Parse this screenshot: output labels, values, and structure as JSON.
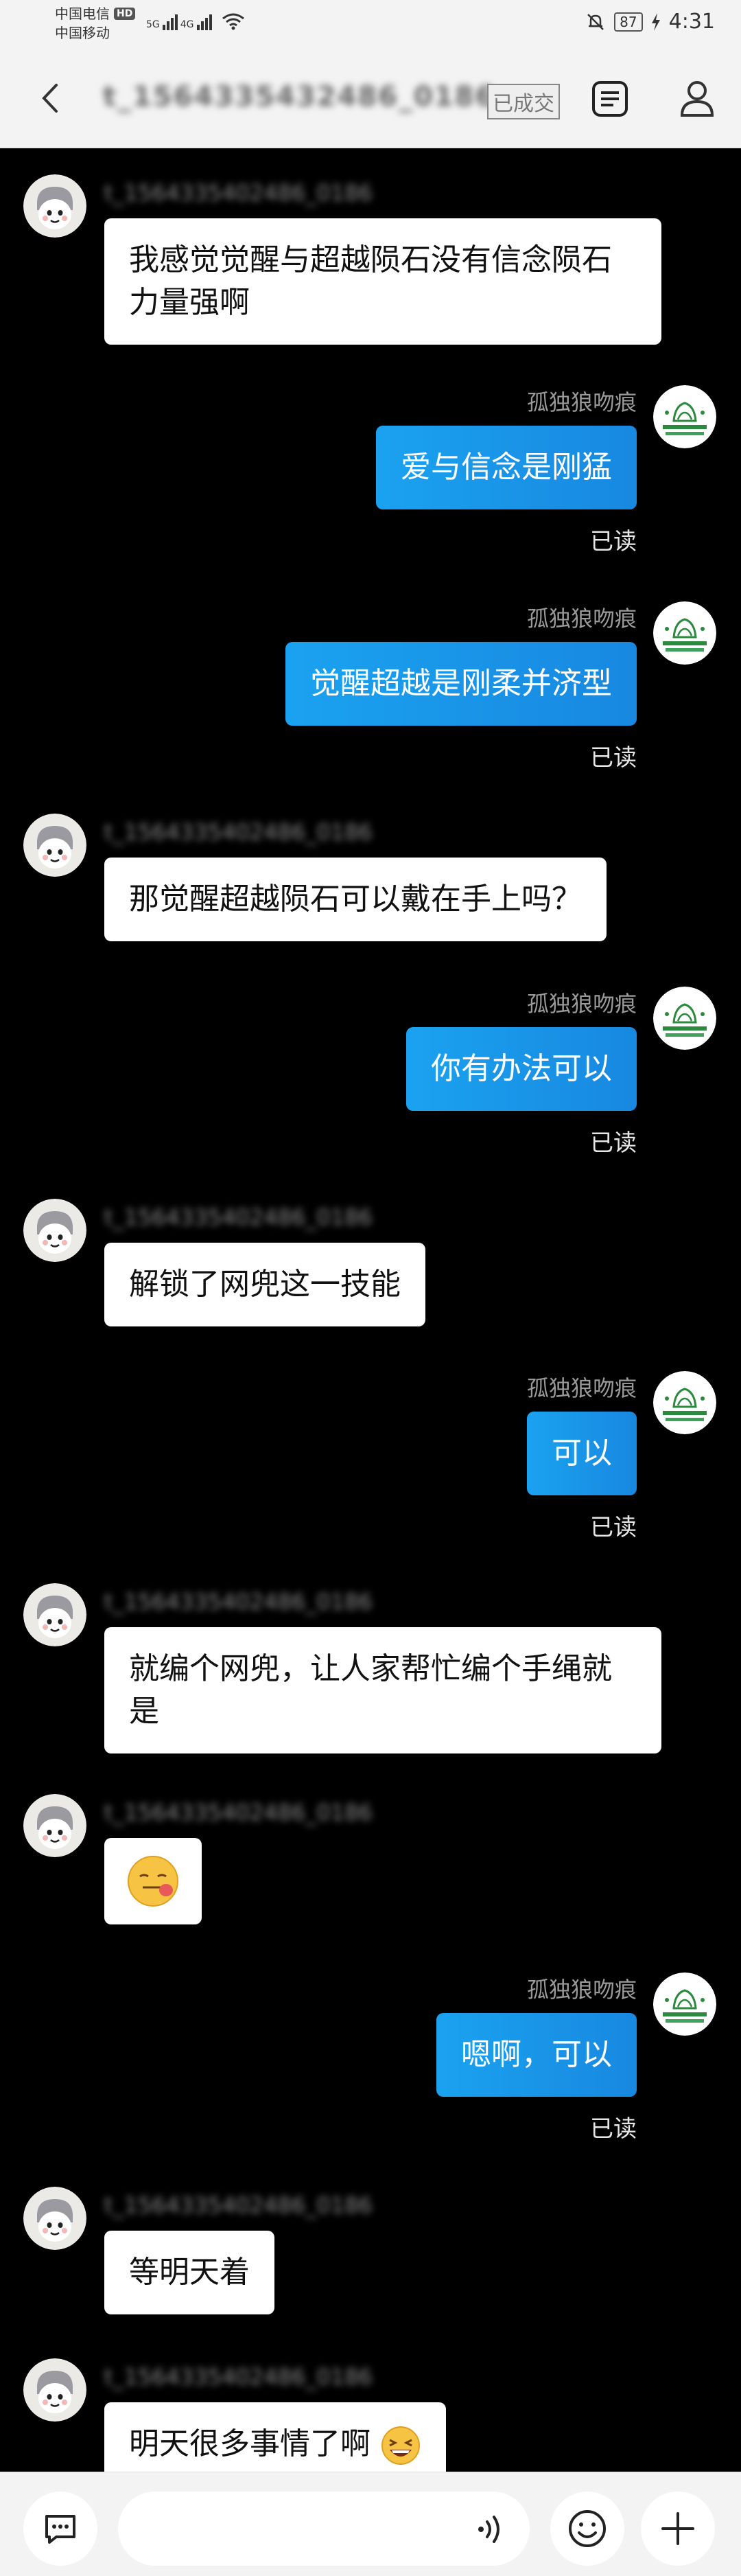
{
  "status_bar": {
    "carrier_1": "中国电信",
    "hd": "HD",
    "carrier_2": "中国移动",
    "net_1": "5G",
    "net_2": "4G",
    "battery": "87",
    "time": "4:31"
  },
  "header": {
    "title": "t_1564335432486_0186",
    "deal_status": "已成交"
  },
  "messages": [
    {
      "side": "left",
      "sender": "t_1564335402486_0186",
      "text": "我感觉觉醒与超越陨石没有信念陨石力量强啊"
    },
    {
      "side": "right",
      "sender": "孤独狼吻痕",
      "text": "爱与信念是刚猛",
      "status": "已读"
    },
    {
      "side": "right",
      "sender": "孤独狼吻痕",
      "text": "觉醒超越是刚柔并济型",
      "status": "已读"
    },
    {
      "side": "left",
      "sender": "t_1564335402486_0186",
      "text": "那觉醒超越陨石可以戴在手上吗？"
    },
    {
      "side": "right",
      "sender": "孤独狼吻痕",
      "text": "你有办法可以",
      "status": "已读"
    },
    {
      "side": "left",
      "sender": "t_1564335402486_0186",
      "text": "解锁了网兜这一技能"
    },
    {
      "side": "right",
      "sender": "孤独狼吻痕",
      "text": "可以",
      "status": "已读"
    },
    {
      "side": "left",
      "sender": "t_1564335402486_0186",
      "text": "就编个网兜，让人家帮忙编个手绳就是"
    },
    {
      "side": "left",
      "sender": "t_1564335402486_0186",
      "text": "",
      "emoji": "tongue-face-emoji"
    },
    {
      "side": "right",
      "sender": "孤独狼吻痕",
      "text": "嗯啊，可以",
      "status": "已读"
    },
    {
      "side": "left",
      "sender": "t_1564335402486_0186",
      "text": "等明天着"
    },
    {
      "side": "left",
      "sender": "t_1564335402486_0186",
      "text": "明天很多事情了啊",
      "emoji": "laughing-face-emoji"
    }
  ],
  "input": {
    "placeholder": ""
  },
  "colors": {
    "accent_bubble": "#1a98ea",
    "background": "#000000",
    "bar": "#f3f3f3"
  }
}
